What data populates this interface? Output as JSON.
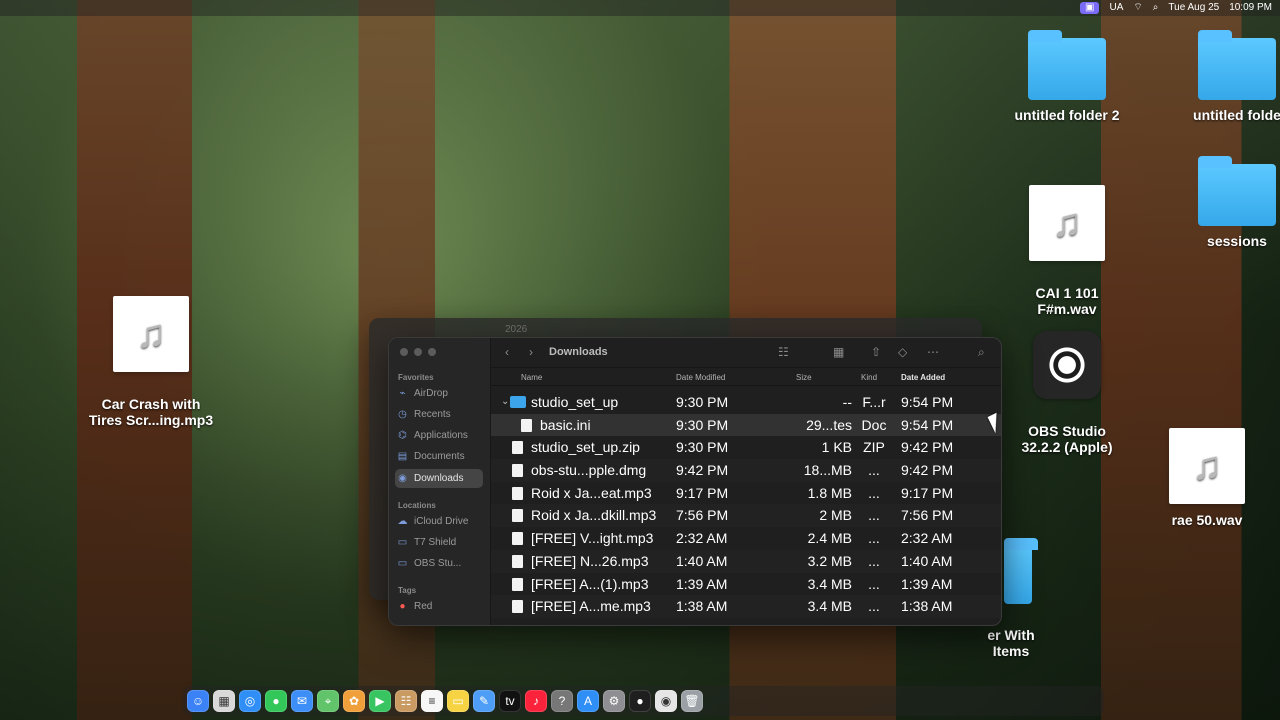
{
  "menubar": {
    "apple": "",
    "status": [
      "UA",
      "Tue Aug 25",
      "10:09 PM"
    ]
  },
  "desktop": {
    "items": [
      {
        "name": "untitled folder 2",
        "icon": "folder"
      },
      {
        "name": "untitled folde",
        "icon": "folder"
      },
      {
        "name": "CAI 1 101\nF#m.wav",
        "icon": "audio"
      },
      {
        "name": "sessions",
        "icon": "folder"
      },
      {
        "name": "Car Crash with\nTires Scr...ing.mp3",
        "icon": "audio"
      },
      {
        "name": "OBS Studio\n32.2.2 (Apple)",
        "icon": "obs"
      },
      {
        "name": "rae 50.wav",
        "icon": "audio"
      },
      {
        "name": "er With\nItems",
        "icon": "folder"
      }
    ]
  },
  "finder": {
    "title": "Downloads",
    "back_title": "2026",
    "sidebar": {
      "favorites_label": "Favorites",
      "locations_label": "Locations",
      "tags_label": "Tags",
      "favorites": [
        {
          "label": "AirDrop",
          "icon": "airdrop-icon"
        },
        {
          "label": "Recents",
          "icon": "clock-icon"
        },
        {
          "label": "Applications",
          "icon": "applications-icon"
        },
        {
          "label": "Documents",
          "icon": "document-icon"
        },
        {
          "label": "Downloads",
          "icon": "download-icon"
        }
      ],
      "locations": [
        {
          "label": "iCloud Drive",
          "icon": "cloud-icon"
        },
        {
          "label": "T7 Shield",
          "icon": "drive-icon"
        },
        {
          "label": "OBS Stu...",
          "icon": "drive-icon"
        }
      ],
      "tags": [
        {
          "label": "Red",
          "color": "#ff5a52"
        }
      ]
    },
    "columns": {
      "name": "Name",
      "date_modified": "Date Modified",
      "size": "Size",
      "kind": "Kind",
      "date_added": "Date Added"
    },
    "files": [
      {
        "name": "studio_set_up",
        "date": "9:30 PM",
        "size": "--",
        "kind": "F...r",
        "added": "9:54 PM",
        "type": "folder",
        "disclosure": "⌄"
      },
      {
        "name": "basic.ini",
        "date": "9:30 PM",
        "size": "29...tes",
        "kind": "Doc",
        "added": "9:54 PM",
        "type": "file"
      },
      {
        "name": "studio_set_up.zip",
        "date": "9:30 PM",
        "size": "1 KB",
        "kind": "ZIP",
        "added": "9:42 PM",
        "type": "file"
      },
      {
        "name": "obs-stu...pple.dmg",
        "date": "9:42 PM",
        "size": "18...MB",
        "kind": "...",
        "added": "9:42 PM",
        "type": "file"
      },
      {
        "name": "Roid x Ja...eat.mp3",
        "date": "9:17 PM",
        "size": "1.8 MB",
        "kind": "...",
        "added": "9:17 PM",
        "type": "audio"
      },
      {
        "name": "Roid x Ja...dkill.mp3",
        "date": "7:56 PM",
        "size": "2 MB",
        "kind": "...",
        "added": "7:56 PM",
        "type": "audio"
      },
      {
        "name": "[FREE] V...ight.mp3",
        "date": "2:32 AM",
        "size": "2.4 MB",
        "kind": "...",
        "added": "2:32 AM",
        "type": "audio"
      },
      {
        "name": "[FREE] N...26.mp3",
        "date": "1:40 AM",
        "size": "3.2 MB",
        "kind": "...",
        "added": "1:40 AM",
        "type": "audio"
      },
      {
        "name": "[FREE] A...(1).mp3",
        "date": "1:39 AM",
        "size": "3.4 MB",
        "kind": "...",
        "added": "1:39 AM",
        "type": "audio"
      },
      {
        "name": "[FREE] A...me.mp3",
        "date": "1:38 AM",
        "size": "3.4 MB",
        "kind": "...",
        "added": "1:38 AM",
        "type": "audio"
      }
    ]
  },
  "dock": {
    "apps": [
      {
        "name": "finder",
        "symbol": "☺",
        "color": "#3b82f6"
      },
      {
        "name": "launchpad",
        "symbol": "▦",
        "color": "#d9d9d9"
      },
      {
        "name": "safari",
        "symbol": "◎",
        "color": "#2f8ff7"
      },
      {
        "name": "messages",
        "symbol": "●",
        "color": "#33c759"
      },
      {
        "name": "mail",
        "symbol": "✉",
        "color": "#3d8ef7"
      },
      {
        "name": "maps",
        "symbol": "⌖",
        "color": "#61c46a"
      },
      {
        "name": "photos",
        "symbol": "✿",
        "color": "#f0a03a"
      },
      {
        "name": "facetime",
        "symbol": "▶",
        "color": "#38c460"
      },
      {
        "name": "contacts",
        "symbol": "☷",
        "color": "#c99b63"
      },
      {
        "name": "reminders",
        "symbol": "≡",
        "color": "#f7f7f7"
      },
      {
        "name": "notes",
        "symbol": "▭",
        "color": "#f5d342"
      },
      {
        "name": "freeform",
        "symbol": "✎",
        "color": "#4e9ef8"
      },
      {
        "name": "tv",
        "symbol": "tv",
        "color": "#111111"
      },
      {
        "name": "music",
        "symbol": "♪",
        "color": "#fa233b"
      },
      {
        "name": "unknown",
        "symbol": "?",
        "color": "#777777"
      },
      {
        "name": "app-store",
        "symbol": "A",
        "color": "#2f8ff7"
      },
      {
        "name": "settings",
        "symbol": "⚙",
        "color": "#8e8e93"
      },
      {
        "name": "obs",
        "symbol": "●",
        "color": "#1f1f1f"
      },
      {
        "name": "chrome",
        "symbol": "◉",
        "color": "#e6e6e6"
      },
      {
        "name": "trash",
        "symbol": "🗑",
        "color": "#9aa0a6"
      }
    ]
  }
}
